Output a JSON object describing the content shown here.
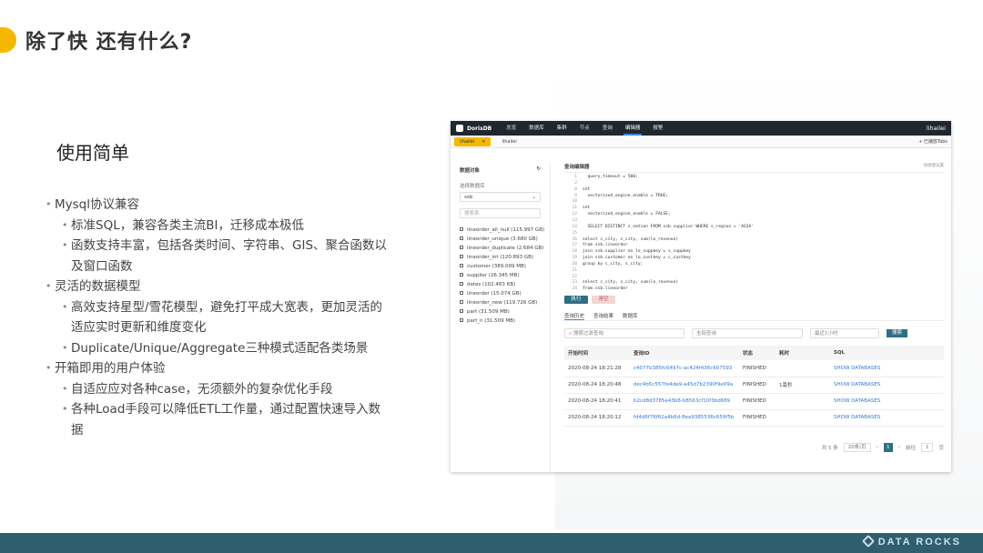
{
  "slide": {
    "title": "除了快 还有什么?",
    "section": "使用简单",
    "bullets": [
      {
        "level": 1,
        "text": "Mysql协议兼容"
      },
      {
        "level": 2,
        "text": "标准SQL，兼容各类主流BI，迁移成本极低"
      },
      {
        "level": 2,
        "text": "函数支持丰富，包括各类时间、字符串、GIS、聚合函数以及窗口函数"
      },
      {
        "level": 1,
        "text": "灵活的数据模型"
      },
      {
        "level": 2,
        "text": "高效支持星型/雪花模型，避免打平成大宽表，更加灵活的适应实时更新和维度变化"
      },
      {
        "level": 2,
        "text": "Duplicate/Unique/Aggregate三种模式适配各类场景"
      },
      {
        "level": 1,
        "text": "开箱即用的用户体验"
      },
      {
        "level": 2,
        "text": "自适应应对各种case，无须额外的复杂优化手段"
      },
      {
        "level": 2,
        "text": "各种Load手段可以降低ETL工作量，通过配置快速导入数据"
      }
    ],
    "brand": "DATA ROCKS",
    "accent_color": "#f5b800",
    "footer_color": "#2f5f6e"
  },
  "app": {
    "name": "DorisDB",
    "nav": [
      "总览",
      "数据库",
      "集群",
      "节点",
      "查询",
      "编辑器",
      "报警"
    ],
    "active_nav": "编辑器",
    "user": "lihailei",
    "tabs": [
      {
        "label": "lihailei",
        "active": true
      },
      {
        "label": "lihailei",
        "active": false
      }
    ],
    "add_tab": "+ 已播放Tabs",
    "objects_title": "数据对象",
    "select_db_label": "选择数据库",
    "db_value": "ssb",
    "search_placeholder": "搜索表",
    "tables": [
      "lineorder_all_null (115.997 GB)",
      "lineorder_unique (3.680 GB)",
      "lineorder_duplicate (2.684 GB)",
      "lineorder_int (120.893 GB)",
      "customer (389.099 MB)",
      "supplier (26.345 MB)",
      "dates (102.483 KB)",
      "lineorder (15.074 GB)",
      "lineorder_new (119.726 GB)",
      "part (31.509 MB)",
      "part_n (31.509 MB)"
    ],
    "editor_title": "查询编辑器",
    "editor_hint": "快捷键设置",
    "code_lines": [
      {
        "n": "1",
        "t": "  query_timeout = 500;"
      },
      {
        "n": "2",
        "t": ""
      },
      {
        "n": "8",
        "t": "set"
      },
      {
        "n": "9",
        "t": "  vectorized_engine_enable = TRUE;"
      },
      {
        "n": "10",
        "t": ""
      },
      {
        "n": "11",
        "t": "set"
      },
      {
        "n": "12",
        "t": "  vectorized_engine_enable = FALSE;"
      },
      {
        "n": "13",
        "t": ""
      },
      {
        "n": "14",
        "t": "  SELECT DISTINCT s_nation FROM ssb.supplier WHERE s_region = 'ASIA'"
      },
      {
        "n": "15",
        "t": ""
      },
      {
        "n": "16",
        "t": "select c_city, s_city, sum(lo_revenue)"
      },
      {
        "n": "17",
        "t": "from ssb.lineorder"
      },
      {
        "n": "18",
        "t": "join ssb.supplier on lo_suppkey = s_suppkey"
      },
      {
        "n": "19",
        "t": "join ssb.customer on lo_custkey = c_custkey"
      },
      {
        "n": "20",
        "t": "group by c_city, s_city;"
      },
      {
        "n": "21",
        "t": ""
      },
      {
        "n": "22",
        "t": ""
      },
      {
        "n": "23",
        "t": "select c_city, s_city, sum(lo_revenue)"
      },
      {
        "n": "24",
        "t": "from ssb.lineorder"
      }
    ],
    "run_label": "执行",
    "clear_label": "清空",
    "sub_tabs": [
      "查询历史",
      "查询结果",
      "数据库"
    ],
    "filter_search": "搜索过滤查询",
    "filter_all": "全部查询",
    "filter_time": "最近1小时",
    "filter_button": "搜索",
    "columns": [
      "开始时间",
      "查询ID",
      "状态",
      "耗时",
      "SQL"
    ],
    "rows": [
      {
        "time": "2020-08-24 18:21:28",
        "id": "c4077b385fc6497c-ac424f436c607593",
        "status": "FINISHED",
        "cost": "",
        "sql": "SHOW DATABASES"
      },
      {
        "time": "2020-08-24 18:20:48",
        "id": "dec4b5c557fe4de9-a45d7b2390f9e09a",
        "status": "FINISHED",
        "cost": "1毫秒",
        "sql": "SHOW DATABASES"
      },
      {
        "time": "2020-08-24 18:20:41",
        "id": "b2cd8d3785e43b8-b8563cf10f3bd689",
        "status": "FINISHED",
        "cost": "",
        "sql": "SHOW DATABASES"
      },
      {
        "time": "2020-08-24 18:20:12",
        "id": "fd4d6f76f62a4b6d-8ea9385536c659f5b",
        "status": "FINISHED",
        "cost": "",
        "sql": "SHOW DATABASES"
      }
    ],
    "pager_total": "共 5 条",
    "pager_size": "20条/页",
    "pager_current": "1",
    "pager_goto": "前往",
    "pager_goto_value": "1",
    "pager_page": "页"
  }
}
